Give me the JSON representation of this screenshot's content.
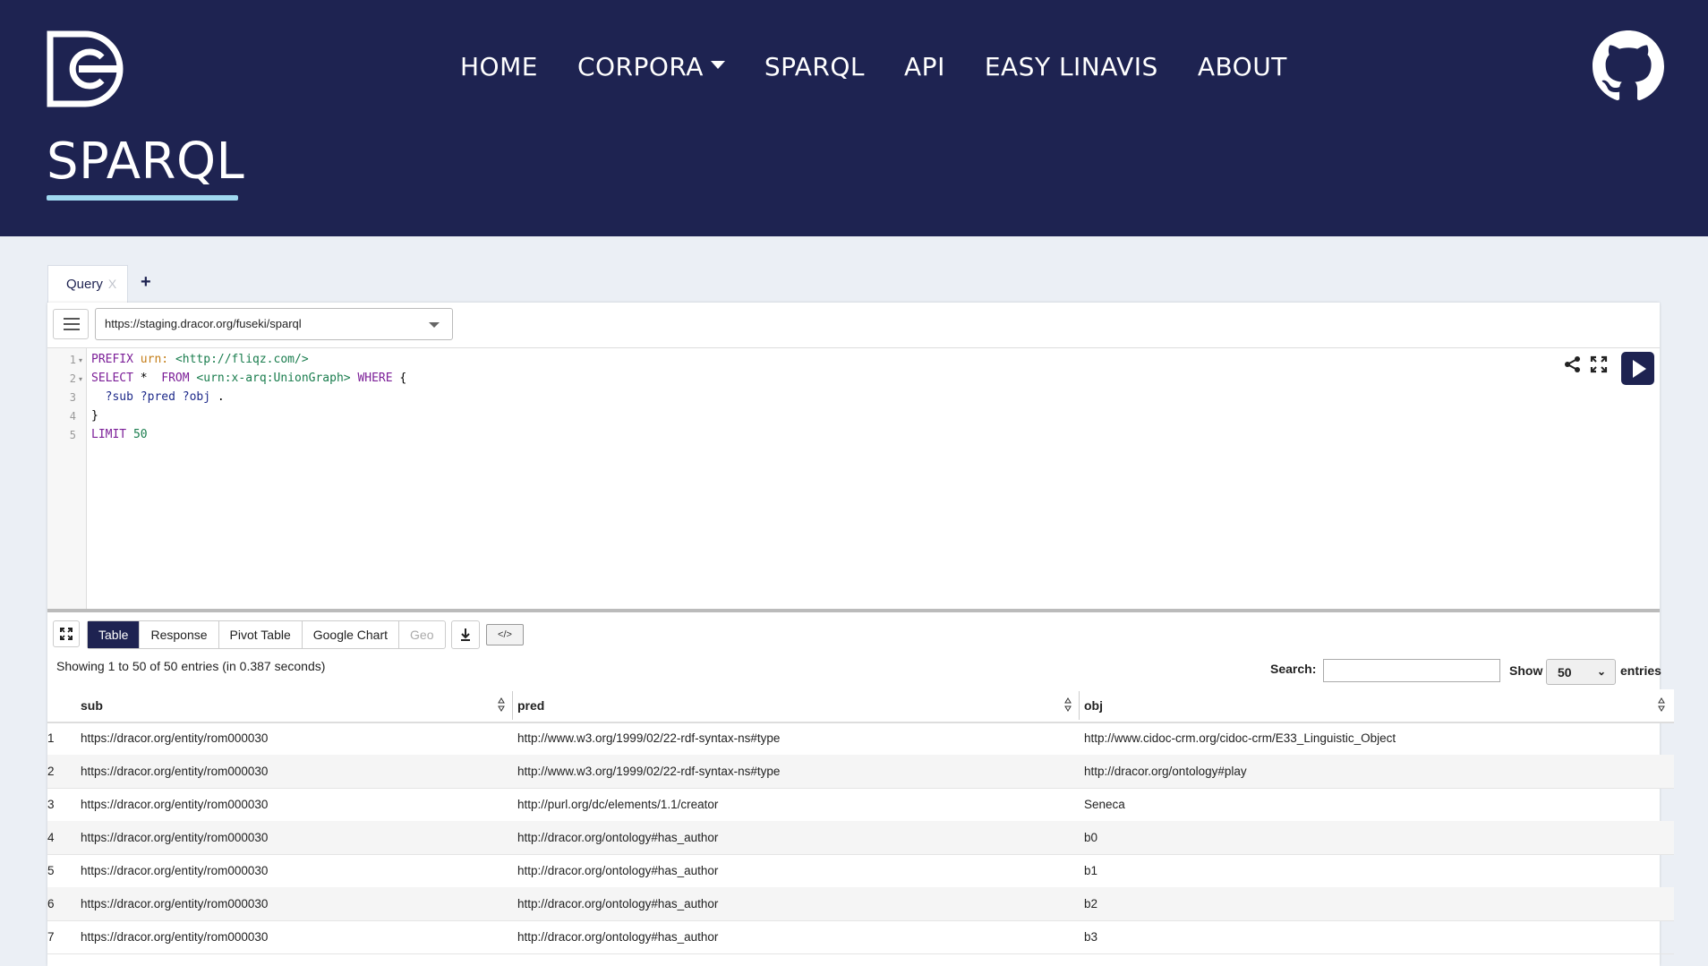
{
  "nav": {
    "items": [
      {
        "label": "HOME"
      },
      {
        "label": "CORPORA"
      },
      {
        "label": "SPARQL"
      },
      {
        "label": "API"
      },
      {
        "label": "EASY LINAVIS"
      },
      {
        "label": "ABOUT"
      }
    ]
  },
  "page": {
    "title": "SPARQL"
  },
  "tabs": {
    "query_label": "Query",
    "close_label": "X",
    "add_label": "+"
  },
  "endpoint": {
    "url": "https://staging.dracor.org/fuseki/sparql"
  },
  "editor": {
    "line_numbers": [
      "1",
      "2",
      "3",
      "4",
      "5"
    ],
    "line1": {
      "kw": "PREFIX",
      "prefix": "urn:",
      "uri": "<http://fliqz.com/>"
    },
    "line2": {
      "kw1": "SELECT",
      "star": "*",
      "kw2": "FROM",
      "uri": "<urn:x-arq:UnionGraph>",
      "kw3": "WHERE",
      "brace": "{"
    },
    "line3": {
      "vars": "?sub ?pred ?obj",
      "dot": "."
    },
    "line4": {
      "brace": "}"
    },
    "line5": {
      "kw": "LIMIT",
      "num": "50"
    }
  },
  "results": {
    "view_tabs": [
      "Table",
      "Response",
      "Pivot Table",
      "Google Chart",
      "Geo"
    ],
    "active_tab": "Table",
    "embed_label": "</>",
    "showing_text": "Showing 1 to 50 of 50 entries (in 0.387 seconds)",
    "search_label": "Search:",
    "show_label": "Show",
    "page_size": "50",
    "entries_label": "entries",
    "columns": [
      "sub",
      "pred",
      "obj"
    ],
    "rows": [
      {
        "n": "1",
        "sub": "https://dracor.org/entity/rom000030",
        "pred": "http://www.w3.org/1999/02/22-rdf-syntax-ns#type",
        "obj": "http://www.cidoc-crm.org/cidoc-crm/E33_Linguistic_Object"
      },
      {
        "n": "2",
        "sub": "https://dracor.org/entity/rom000030",
        "pred": "http://www.w3.org/1999/02/22-rdf-syntax-ns#type",
        "obj": "http://dracor.org/ontology#play"
      },
      {
        "n": "3",
        "sub": "https://dracor.org/entity/rom000030",
        "pred": "http://purl.org/dc/elements/1.1/creator",
        "obj": "Seneca"
      },
      {
        "n": "4",
        "sub": "https://dracor.org/entity/rom000030",
        "pred": "http://dracor.org/ontology#has_author",
        "obj": "b0"
      },
      {
        "n": "5",
        "sub": "https://dracor.org/entity/rom000030",
        "pred": "http://dracor.org/ontology#has_author",
        "obj": "b1"
      },
      {
        "n": "6",
        "sub": "https://dracor.org/entity/rom000030",
        "pred": "http://dracor.org/ontology#has_author",
        "obj": "b2"
      },
      {
        "n": "7",
        "sub": "https://dracor.org/entity/rom000030",
        "pred": "http://dracor.org/ontology#has_author",
        "obj": "b3"
      }
    ]
  },
  "colors": {
    "header_bg": "#1e2351",
    "accent": "#9fd8f0",
    "page_bg": "#ebeff5"
  }
}
